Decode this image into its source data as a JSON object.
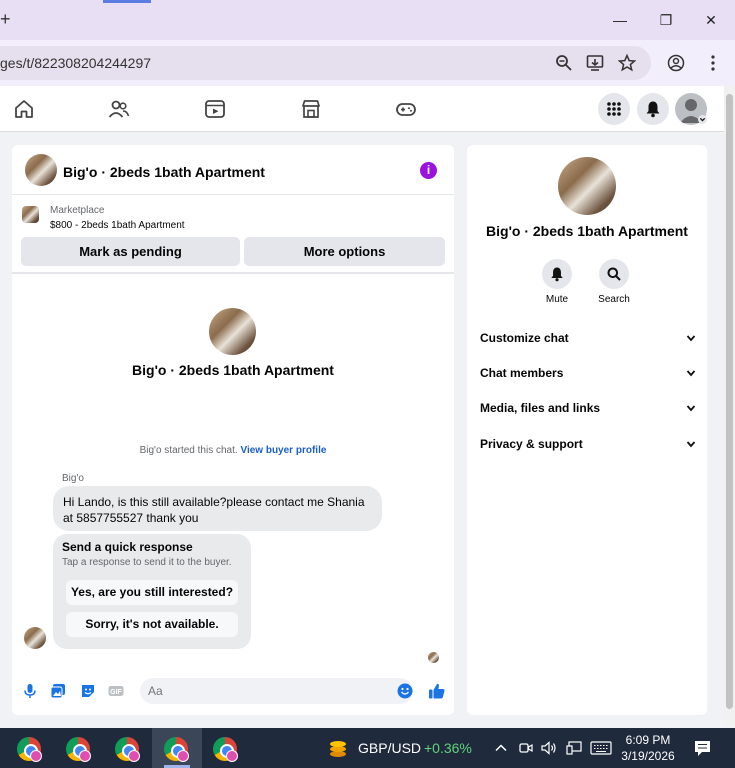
{
  "browser": {
    "new_tab_glyph": "+",
    "url": "ges/t/822308204244297",
    "window_buttons": {
      "minimize": "—",
      "restore": "❐",
      "close": "✕"
    }
  },
  "nav": {
    "icons": [
      "home-icon",
      "friends-icon",
      "video-icon",
      "marketplace-icon",
      "gaming-icon"
    ],
    "right": [
      "menu-grid-icon",
      "notifications-icon",
      "account-icon"
    ]
  },
  "chat": {
    "title": "Big'o · 2beds 1bath Apartment",
    "listing": {
      "label": "Marketplace",
      "price_line": "$800 - 2beds 1bath Apartment"
    },
    "buttons": {
      "mark_pending": "Mark as pending",
      "more_options": "More options"
    },
    "conversation_title": "Big'o · 2beds 1bath Apartment",
    "started_text": "Big'o started this chat.",
    "buyer_link": "View buyer profile",
    "sender_name": "Big'o",
    "message": "Hi Lando, is this still available?please contact me Shania at 5857755527 thank you",
    "quick_response": {
      "title": "Send a quick response",
      "subtitle": "Tap a response to send it to the buyer.",
      "options": [
        "Yes, are you still interested?",
        "Sorry, it's not available."
      ]
    },
    "composer_placeholder": "Aa",
    "accent": "#1b74e4"
  },
  "info_panel": {
    "name": "Big'o · 2beds 1bath Apartment",
    "actions": [
      "Mute",
      "Search"
    ],
    "sections": [
      "Customize chat",
      "Chat members",
      "Media, files and links",
      "Privacy & support"
    ]
  },
  "taskbar": {
    "ticker_pair": "GBP/USD",
    "ticker_change": "+0.36%",
    "time": "6:09 PM",
    "date": "3/19/2026"
  }
}
